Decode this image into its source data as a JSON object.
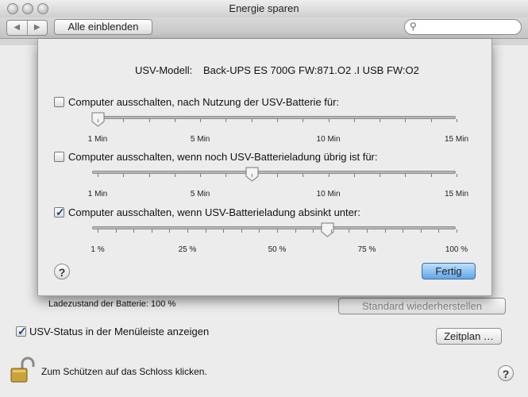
{
  "window": {
    "title": "Energie sparen"
  },
  "toolbar": {
    "back": "◀",
    "forward": "▶",
    "show_all": "Alle einblenden",
    "search_placeholder": ""
  },
  "sheet": {
    "model_label": "USV-Modell:",
    "model_value": "Back-UPS ES 700G FW:871.O2 .I USB FW:O2",
    "options": [
      {
        "label": "Computer ausschalten, nach Nutzung der USV-Batterie für:",
        "checked": false,
        "ticks": [
          "1 Min",
          "5 Min",
          "10 Min",
          "15 Min"
        ],
        "slider_level": 0.0
      },
      {
        "label": "Computer ausschalten, wenn noch USV-Batterieladung übrig ist für:",
        "checked": false,
        "ticks": [
          "1 Min",
          "5 Min",
          "10 Min",
          "15 Min"
        ],
        "slider_level": 0.43
      },
      {
        "label": "Computer ausschalten, wenn USV-Batterieladung absinkt unter:",
        "checked": true,
        "ticks": [
          "1 %",
          "25 %",
          "50 %",
          "75 %",
          "100 %"
        ],
        "slider_level": 0.64
      }
    ],
    "help": "?",
    "done_button": "Fertig"
  },
  "main": {
    "battery_status": "Ladezustand der Batterie: 100 %",
    "restore_defaults": "Standard wiederherstellen",
    "show_status_label": "USV-Status in der Menüleiste anzeigen",
    "show_status_checked": true,
    "schedule_button": "Zeitplan …",
    "lock_text": "Zum Schützen auf das Schloss klicken.",
    "help": "?"
  },
  "colors": {
    "accent": "#5fa6e8",
    "checkmark": "#1a3d8f"
  }
}
